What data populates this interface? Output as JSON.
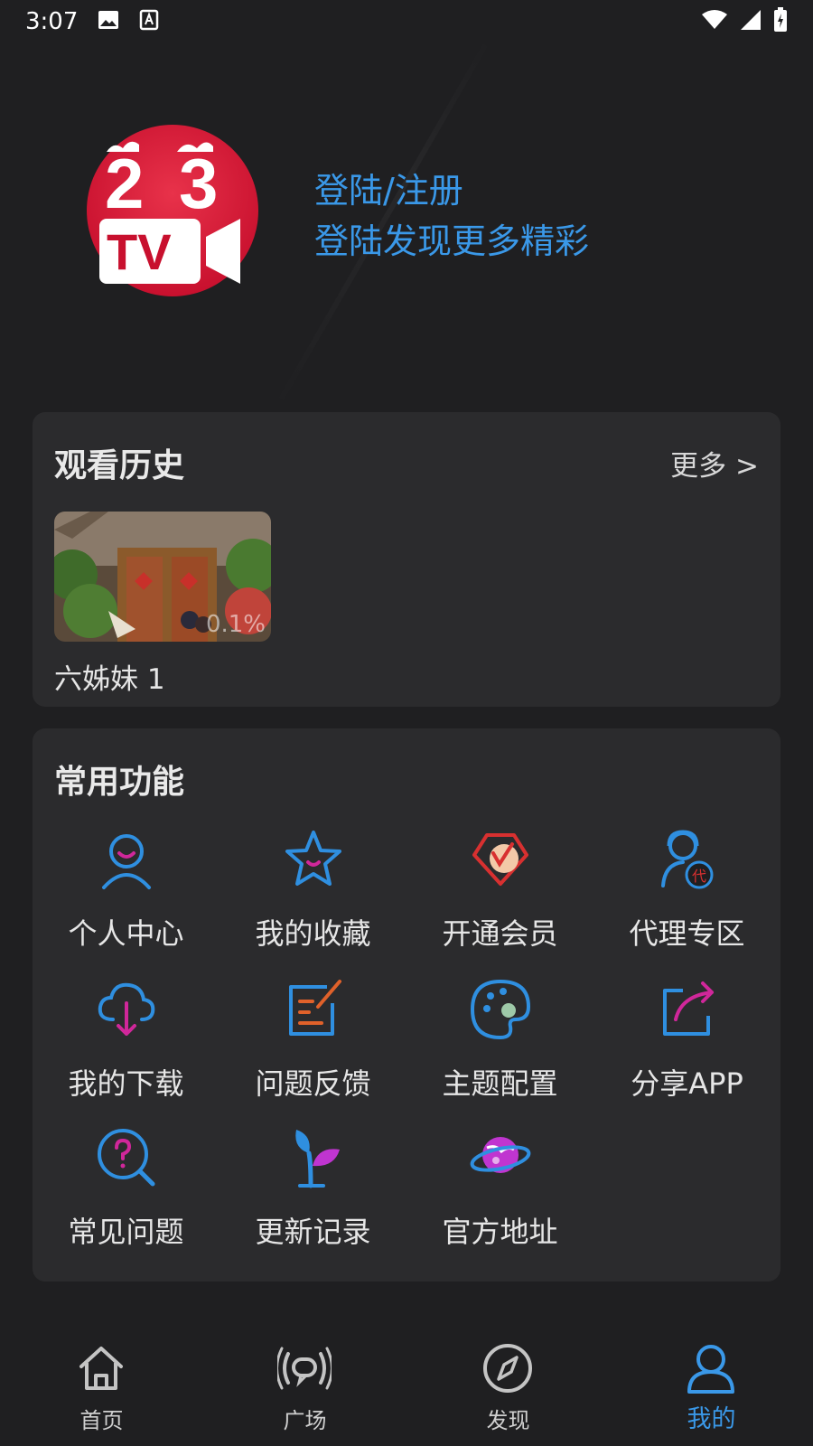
{
  "status_bar": {
    "time": "3:07"
  },
  "profile": {
    "logo_alt": "23TV",
    "login_title": "登陆/注册",
    "login_subtitle": "登陆发现更多精彩"
  },
  "history": {
    "title": "观看历史",
    "more": "更多 >",
    "items": [
      {
        "name": "六姊妹 1",
        "progress": "0.1%"
      }
    ]
  },
  "features": {
    "title": "常用功能",
    "items": [
      {
        "label": "个人中心",
        "icon": "user-center-icon"
      },
      {
        "label": "我的收藏",
        "icon": "star-icon"
      },
      {
        "label": "开通会员",
        "icon": "vip-icon"
      },
      {
        "label": "代理专区",
        "icon": "agent-icon"
      },
      {
        "label": "我的下载",
        "icon": "cloud-download-icon"
      },
      {
        "label": "问题反馈",
        "icon": "feedback-icon"
      },
      {
        "label": "主题配置",
        "icon": "palette-icon"
      },
      {
        "label": "分享APP",
        "icon": "share-icon"
      },
      {
        "label": "常见问题",
        "icon": "faq-icon"
      },
      {
        "label": "更新记录",
        "icon": "sprout-icon"
      },
      {
        "label": "官方地址",
        "icon": "planet-icon"
      }
    ]
  },
  "bottom_nav": {
    "items": [
      {
        "label": "首页",
        "icon": "home-icon"
      },
      {
        "label": "广场",
        "icon": "broadcast-icon"
      },
      {
        "label": "发现",
        "icon": "compass-icon"
      },
      {
        "label": "我的",
        "icon": "profile-icon",
        "active": true
      }
    ]
  },
  "colors": {
    "background": "#1f1f21",
    "card": "#2b2b2d",
    "accent": "#3a98e8",
    "pink": "#d0279a"
  }
}
